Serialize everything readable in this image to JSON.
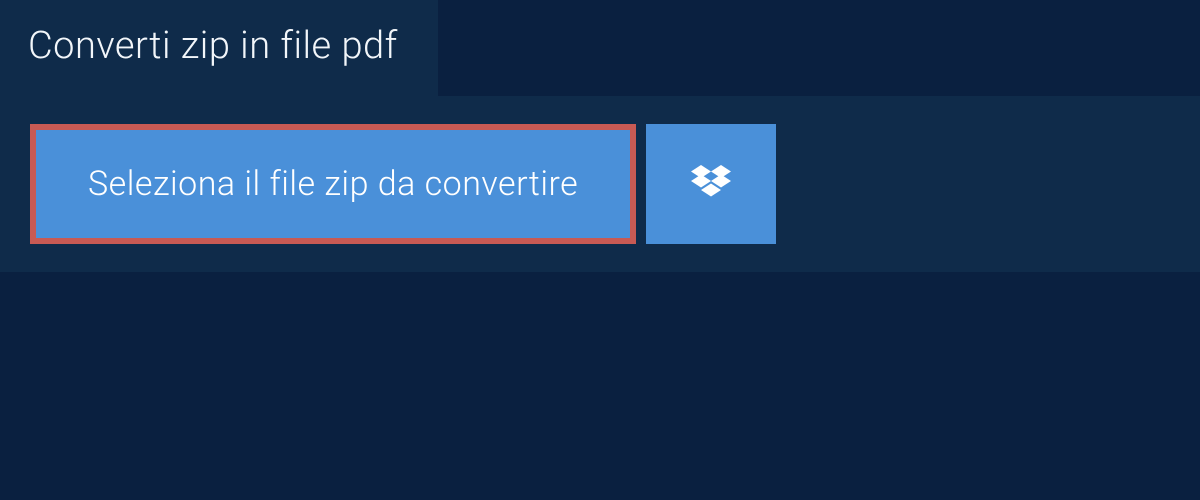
{
  "header": {
    "title": "Converti zip in file pdf"
  },
  "actions": {
    "select_file_label": "Seleziona il file zip da convertire"
  },
  "colors": {
    "background_dark": "#0a2040",
    "panel": "#0f2b4a",
    "button": "#4a90d9",
    "highlight_border": "#c85a54",
    "text_light": "#ffffff"
  }
}
